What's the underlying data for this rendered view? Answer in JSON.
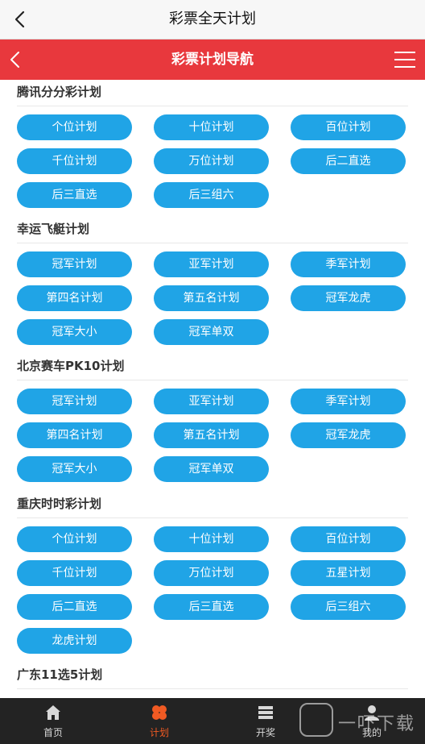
{
  "top_bar": {
    "title": "彩票全天计划"
  },
  "red_bar": {
    "title": "彩票计划导航"
  },
  "sections": [
    {
      "heading": "腾讯分分彩计划",
      "buttons": [
        "个位计划",
        "十位计划",
        "百位计划",
        "千位计划",
        "万位计划",
        "后二直选",
        "后三直选",
        "后三组六"
      ]
    },
    {
      "heading": "幸运飞艇计划",
      "buttons": [
        "冠军计划",
        "亚军计划",
        "季军计划",
        "第四名计划",
        "第五名计划",
        "冠军龙虎",
        "冠军大小",
        "冠军单双"
      ]
    },
    {
      "heading": "北京赛车PK10计划",
      "buttons": [
        "冠军计划",
        "亚军计划",
        "季军计划",
        "第四名计划",
        "第五名计划",
        "冠军龙虎",
        "冠军大小",
        "冠军单双"
      ]
    },
    {
      "heading": "重庆时时彩计划",
      "buttons": [
        "个位计划",
        "十位计划",
        "百位计划",
        "千位计划",
        "万位计划",
        "五星计划",
        "后二直选",
        "后三直选",
        "后三组六",
        "龙虎计划"
      ]
    },
    {
      "heading": "广东11选5计划",
      "buttons": []
    }
  ],
  "bottom_nav": [
    {
      "label": "首页",
      "icon": "home-icon"
    },
    {
      "label": "计划",
      "icon": "clover-icon",
      "active": true
    },
    {
      "label": "开奖",
      "icon": "list-icon"
    },
    {
      "label": "我的",
      "icon": "user-icon"
    }
  ],
  "watermark": {
    "text": "一吓下载"
  },
  "colors": {
    "red_bar": "#e8383d",
    "button": "#20a4e6",
    "nav_bg": "#232323",
    "nav_active": "#f05a23"
  }
}
